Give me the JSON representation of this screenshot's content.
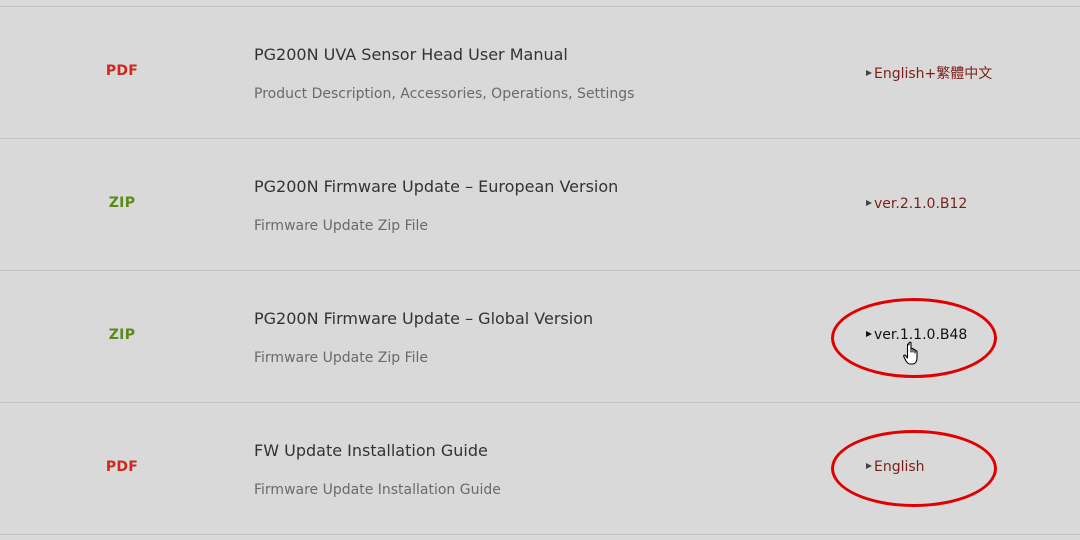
{
  "downloads": [
    {
      "type": "PDF",
      "title": "PG200N UVA Sensor Head User Manual",
      "description": "Product Description, Accessories, Operations, Settings",
      "link": "English+繁體中文"
    },
    {
      "type": "ZIP",
      "title": "PG200N Firmware Update – European Version",
      "description": "Firmware Update Zip File",
      "link": "ver.2.1.0.B12"
    },
    {
      "type": "ZIP",
      "title": "PG200N Firmware Update – Global Version",
      "description": "Firmware Update Zip File",
      "link": "ver.1.1.0.B48"
    },
    {
      "type": "PDF",
      "title": "FW Update Installation Guide",
      "description": "Firmware Update Installation Guide",
      "link": "English"
    }
  ],
  "colors": {
    "pdf": "#d0271e",
    "zip": "#5a8a1a",
    "link": "#7a1f17",
    "callout": "#e00000",
    "background": "#d9d9d9"
  },
  "icons": {
    "link_bullet": "triangle-right-icon",
    "pointer": "hand-pointer-icon"
  }
}
